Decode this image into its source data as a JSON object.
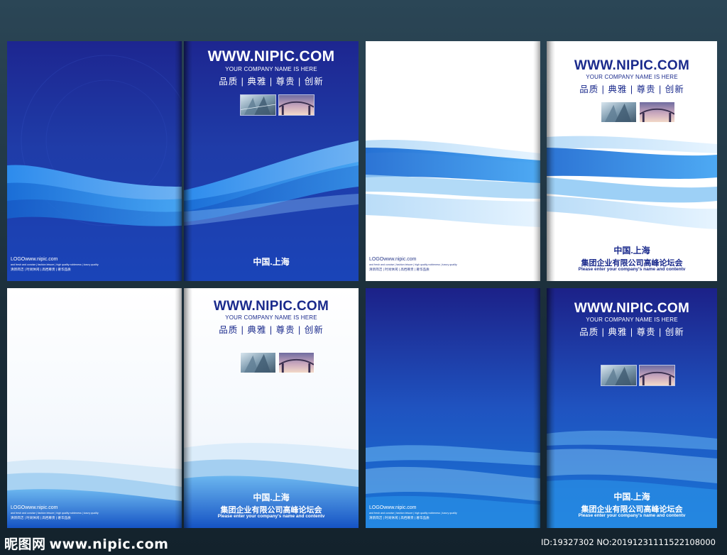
{
  "colors": {
    "navy": "#1a2a8c",
    "dark_bg": "#1f2c9a",
    "bright_blue": "#1a7cd8",
    "frame": "#1b2e3a"
  },
  "covers": {
    "url": "WWW.NIPIC.COM",
    "company": "YOUR COMPANY NAME IS HERE",
    "slogan": "品质 | 典雅 | 尊贵 | 创新",
    "city": "中国.上海",
    "forum": "集团企业有限公司高峰论坛会",
    "forum_sub": "Please enter your company's name and contentv"
  },
  "back": {
    "logo": "LOGOwww.nipic.com",
    "lines": "and fresh and concise | fashion leisure | high quality nobleness | luxury quality",
    "tags": "清新简洁 | 时尚休闲 | 高档尊贵 | 奢华品质"
  },
  "watermark": {
    "brand_cn": "昵图网",
    "brand_url": "www.nipic.com",
    "id_text": "ID:19327302 NO:20191231111522108000"
  },
  "icons": {
    "photo_left": "glass-building-photo-icon",
    "photo_right": "bridge-sunset-photo-icon"
  }
}
